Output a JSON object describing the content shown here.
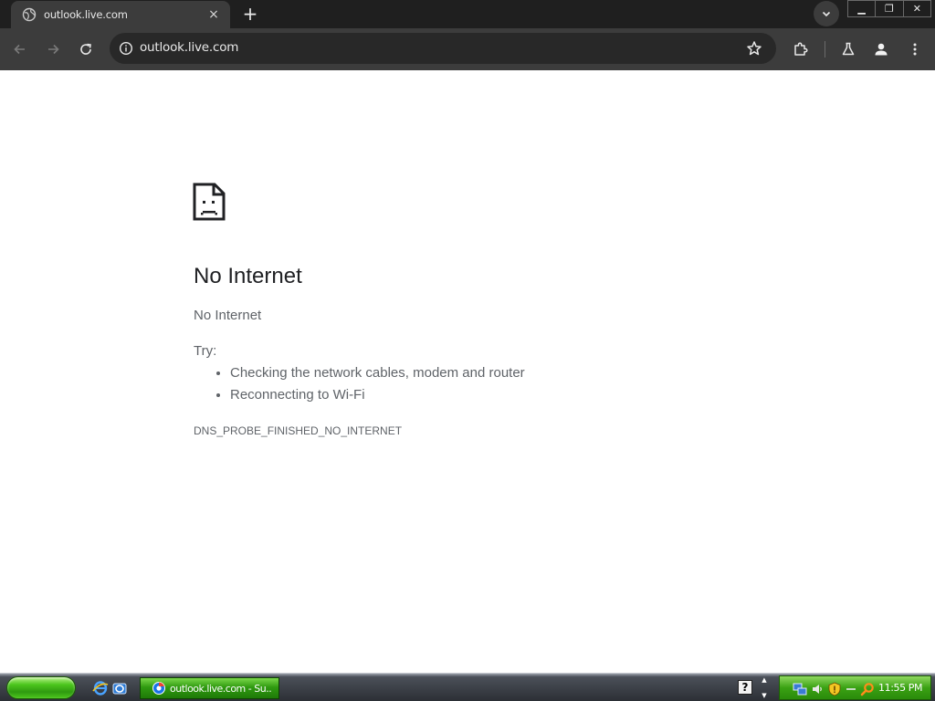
{
  "browser": {
    "tab": {
      "title": "outlook.live.com",
      "favicon": "globe-icon",
      "close": "×"
    },
    "new_tab": "+",
    "address": {
      "url": "outlook.live.com"
    },
    "window_controls": {
      "minimize": "▁",
      "restore": "❐",
      "close": "✕"
    },
    "toolbar_icons": [
      "back-arrow-icon",
      "forward-arrow-icon",
      "reload-icon",
      "info-icon",
      "bookmark-star-icon",
      "extensions-puzzle-icon",
      "labs-flask-icon",
      "profile-icon",
      "menu-kebab-icon"
    ]
  },
  "error_page": {
    "icon": "sad-document-icon",
    "title": "No Internet",
    "subtitle": "No Internet",
    "try_label": "Try:",
    "suggestions": [
      "Checking the network cables, modem and router",
      "Reconnecting to Wi-Fi"
    ],
    "error_code": "DNS_PROBE_FINISHED_NO_INTERNET"
  },
  "taskbar": {
    "task_button": {
      "label": "outlook.live.com - Su..."
    },
    "help": "?",
    "clock": "11:55 PM"
  },
  "colors": {
    "chrome_dark": "#1f1f1f",
    "chrome_toolbar": "#3c3c3c",
    "omnibox": "#282828",
    "title_text": "#202124",
    "body_text": "#5f6368",
    "xp_green": "#2f9a10"
  }
}
